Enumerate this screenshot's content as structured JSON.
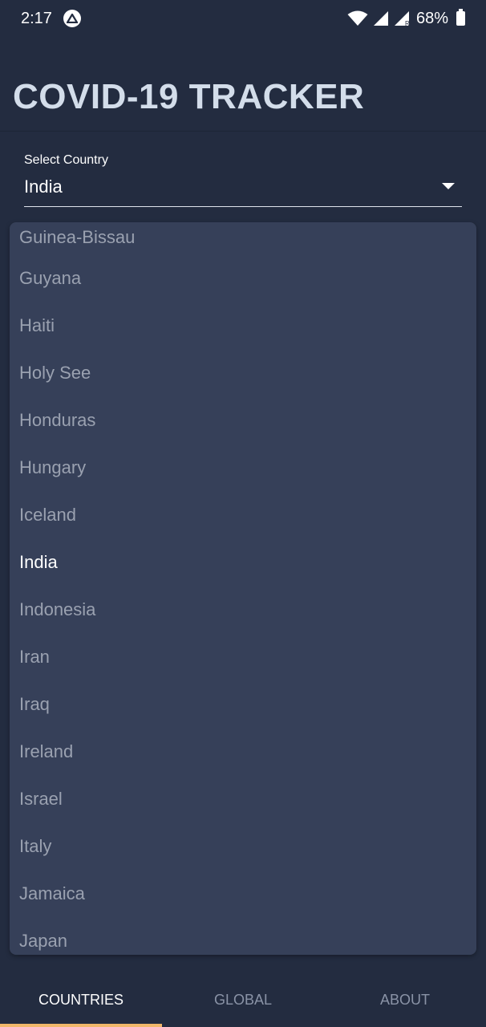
{
  "status_bar": {
    "time": "2:17",
    "battery": "68%",
    "icons": [
      "app-notification-icon",
      "wifi-icon",
      "signal-icon",
      "signal-roaming-icon",
      "battery-icon"
    ]
  },
  "header": {
    "title": "COVID-19 TRACKER"
  },
  "country_select": {
    "label": "Select Country",
    "value": "India"
  },
  "dropdown": {
    "items": [
      "Guinea-Bissau",
      "Guyana",
      "Haiti",
      "Holy See",
      "Honduras",
      "Hungary",
      "Iceland",
      "India",
      "Indonesia",
      "Iran",
      "Iraq",
      "Ireland",
      "Israel",
      "Italy",
      "Jamaica",
      "Japan"
    ],
    "selected": "India"
  },
  "tabs": {
    "countries": "COUNTRIES",
    "global": "GLOBAL",
    "about": "ABOUT",
    "active": "COUNTRIES"
  },
  "colors": {
    "background": "#232c40",
    "dropdown_bg": "#364059",
    "title": "#d3ddea",
    "accent": "#f0b76a",
    "muted_text": "#9aa1b0"
  }
}
